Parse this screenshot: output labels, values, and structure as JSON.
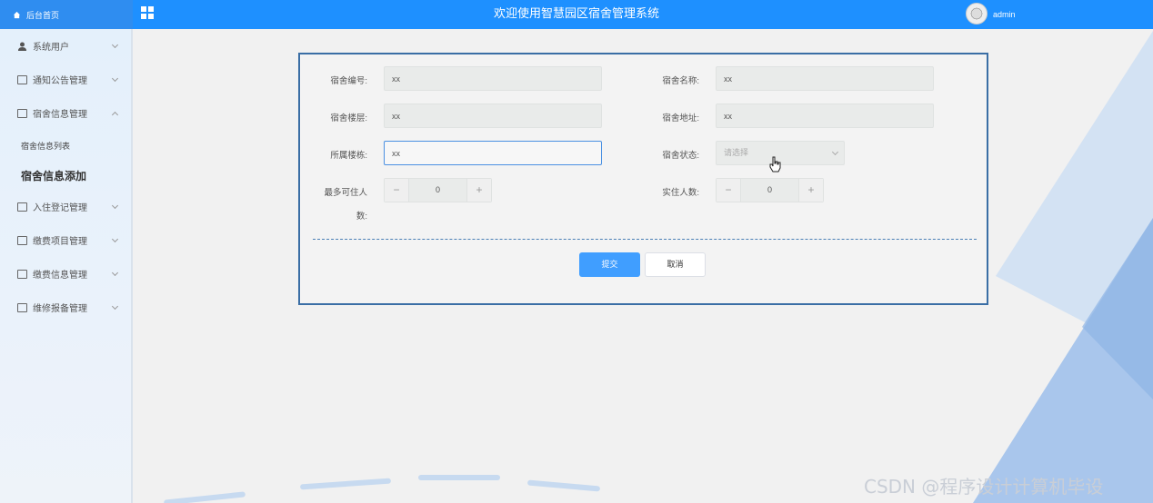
{
  "header": {
    "brand": "后台首页",
    "title": "欢迎使用智慧园区宿舍管理系统",
    "username": "admin"
  },
  "sidebar": {
    "items": [
      {
        "label": "系统用户",
        "icon": "user-icon"
      },
      {
        "label": "通知公告管理",
        "icon": "document-icon"
      },
      {
        "label": "宿舍信息管理",
        "icon": "document-icon",
        "expanded": true
      },
      {
        "label": "入住登记管理",
        "icon": "document-icon"
      },
      {
        "label": "缴费项目管理",
        "icon": "document-icon"
      },
      {
        "label": "缴费信息管理",
        "icon": "document-icon"
      },
      {
        "label": "维修报备管理",
        "icon": "document-icon"
      }
    ],
    "subitems": [
      {
        "label": "宿舍信息列表"
      },
      {
        "label": "宿舍信息添加",
        "active": true
      }
    ]
  },
  "form": {
    "dorm_no_label": "宿舍编号:",
    "dorm_no_value": "xx",
    "dorm_name_label": "宿舍名称:",
    "dorm_name_value": "xx",
    "floor_label": "宿舍楼层:",
    "floor_value": "xx",
    "address_label": "宿舍地址:",
    "address_value": "xx",
    "building_label": "所属楼栋:",
    "building_value": "xx",
    "status_label": "宿舍状态:",
    "status_placeholder": "请选择",
    "capacity_label_line1": "最多可住人",
    "capacity_label_line2": "数:",
    "capacity_value": "0",
    "occupancy_label": "实住人数:",
    "occupancy_value": "0",
    "minus_symbol": "−",
    "plus_symbol": "+",
    "submit_label": "提交",
    "cancel_label": "取消"
  },
  "watermark": "CSDN @程序设计计算机毕设",
  "colors": {
    "header_bg": "#1e90ff",
    "primary_button": "#409eff",
    "panel_border": "#3a6ea5"
  }
}
